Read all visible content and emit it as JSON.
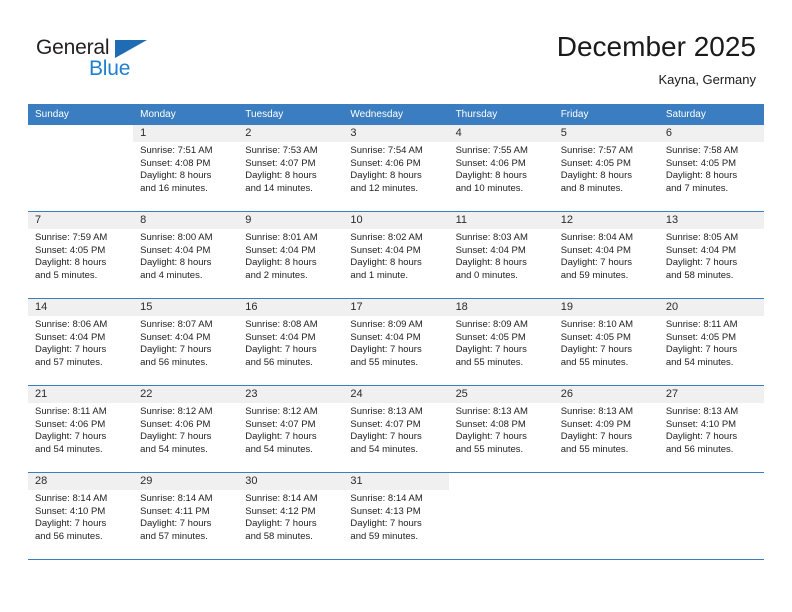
{
  "logo": {
    "word_one": "General",
    "word_two": "Blue",
    "triangle_color": "#1f6cb4",
    "blue_color": "#1f7fd0"
  },
  "header": {
    "title": "December 2025",
    "subtitle": "Kayna, Germany",
    "header_bg": "#3a7dc0",
    "daynum_bg": "#f0f0f0"
  },
  "weekdays": [
    "Sunday",
    "Monday",
    "Tuesday",
    "Wednesday",
    "Thursday",
    "Friday",
    "Saturday"
  ],
  "weeks": [
    [
      {
        "day": "",
        "sunrise": "",
        "sunset": "",
        "daylight1": "",
        "daylight2": ""
      },
      {
        "day": "1",
        "sunrise": "Sunrise: 7:51 AM",
        "sunset": "Sunset: 4:08 PM",
        "daylight1": "Daylight: 8 hours",
        "daylight2": "and 16 minutes."
      },
      {
        "day": "2",
        "sunrise": "Sunrise: 7:53 AM",
        "sunset": "Sunset: 4:07 PM",
        "daylight1": "Daylight: 8 hours",
        "daylight2": "and 14 minutes."
      },
      {
        "day": "3",
        "sunrise": "Sunrise: 7:54 AM",
        "sunset": "Sunset: 4:06 PM",
        "daylight1": "Daylight: 8 hours",
        "daylight2": "and 12 minutes."
      },
      {
        "day": "4",
        "sunrise": "Sunrise: 7:55 AM",
        "sunset": "Sunset: 4:06 PM",
        "daylight1": "Daylight: 8 hours",
        "daylight2": "and 10 minutes."
      },
      {
        "day": "5",
        "sunrise": "Sunrise: 7:57 AM",
        "sunset": "Sunset: 4:05 PM",
        "daylight1": "Daylight: 8 hours",
        "daylight2": "and 8 minutes."
      },
      {
        "day": "6",
        "sunrise": "Sunrise: 7:58 AM",
        "sunset": "Sunset: 4:05 PM",
        "daylight1": "Daylight: 8 hours",
        "daylight2": "and 7 minutes."
      }
    ],
    [
      {
        "day": "7",
        "sunrise": "Sunrise: 7:59 AM",
        "sunset": "Sunset: 4:05 PM",
        "daylight1": "Daylight: 8 hours",
        "daylight2": "and 5 minutes."
      },
      {
        "day": "8",
        "sunrise": "Sunrise: 8:00 AM",
        "sunset": "Sunset: 4:04 PM",
        "daylight1": "Daylight: 8 hours",
        "daylight2": "and 4 minutes."
      },
      {
        "day": "9",
        "sunrise": "Sunrise: 8:01 AM",
        "sunset": "Sunset: 4:04 PM",
        "daylight1": "Daylight: 8 hours",
        "daylight2": "and 2 minutes."
      },
      {
        "day": "10",
        "sunrise": "Sunrise: 8:02 AM",
        "sunset": "Sunset: 4:04 PM",
        "daylight1": "Daylight: 8 hours",
        "daylight2": "and 1 minute."
      },
      {
        "day": "11",
        "sunrise": "Sunrise: 8:03 AM",
        "sunset": "Sunset: 4:04 PM",
        "daylight1": "Daylight: 8 hours",
        "daylight2": "and 0 minutes."
      },
      {
        "day": "12",
        "sunrise": "Sunrise: 8:04 AM",
        "sunset": "Sunset: 4:04 PM",
        "daylight1": "Daylight: 7 hours",
        "daylight2": "and 59 minutes."
      },
      {
        "day": "13",
        "sunrise": "Sunrise: 8:05 AM",
        "sunset": "Sunset: 4:04 PM",
        "daylight1": "Daylight: 7 hours",
        "daylight2": "and 58 minutes."
      }
    ],
    [
      {
        "day": "14",
        "sunrise": "Sunrise: 8:06 AM",
        "sunset": "Sunset: 4:04 PM",
        "daylight1": "Daylight: 7 hours",
        "daylight2": "and 57 minutes."
      },
      {
        "day": "15",
        "sunrise": "Sunrise: 8:07 AM",
        "sunset": "Sunset: 4:04 PM",
        "daylight1": "Daylight: 7 hours",
        "daylight2": "and 56 minutes."
      },
      {
        "day": "16",
        "sunrise": "Sunrise: 8:08 AM",
        "sunset": "Sunset: 4:04 PM",
        "daylight1": "Daylight: 7 hours",
        "daylight2": "and 56 minutes."
      },
      {
        "day": "17",
        "sunrise": "Sunrise: 8:09 AM",
        "sunset": "Sunset: 4:04 PM",
        "daylight1": "Daylight: 7 hours",
        "daylight2": "and 55 minutes."
      },
      {
        "day": "18",
        "sunrise": "Sunrise: 8:09 AM",
        "sunset": "Sunset: 4:05 PM",
        "daylight1": "Daylight: 7 hours",
        "daylight2": "and 55 minutes."
      },
      {
        "day": "19",
        "sunrise": "Sunrise: 8:10 AM",
        "sunset": "Sunset: 4:05 PM",
        "daylight1": "Daylight: 7 hours",
        "daylight2": "and 55 minutes."
      },
      {
        "day": "20",
        "sunrise": "Sunrise: 8:11 AM",
        "sunset": "Sunset: 4:05 PM",
        "daylight1": "Daylight: 7 hours",
        "daylight2": "and 54 minutes."
      }
    ],
    [
      {
        "day": "21",
        "sunrise": "Sunrise: 8:11 AM",
        "sunset": "Sunset: 4:06 PM",
        "daylight1": "Daylight: 7 hours",
        "daylight2": "and 54 minutes."
      },
      {
        "day": "22",
        "sunrise": "Sunrise: 8:12 AM",
        "sunset": "Sunset: 4:06 PM",
        "daylight1": "Daylight: 7 hours",
        "daylight2": "and 54 minutes."
      },
      {
        "day": "23",
        "sunrise": "Sunrise: 8:12 AM",
        "sunset": "Sunset: 4:07 PM",
        "daylight1": "Daylight: 7 hours",
        "daylight2": "and 54 minutes."
      },
      {
        "day": "24",
        "sunrise": "Sunrise: 8:13 AM",
        "sunset": "Sunset: 4:07 PM",
        "daylight1": "Daylight: 7 hours",
        "daylight2": "and 54 minutes."
      },
      {
        "day": "25",
        "sunrise": "Sunrise: 8:13 AM",
        "sunset": "Sunset: 4:08 PM",
        "daylight1": "Daylight: 7 hours",
        "daylight2": "and 55 minutes."
      },
      {
        "day": "26",
        "sunrise": "Sunrise: 8:13 AM",
        "sunset": "Sunset: 4:09 PM",
        "daylight1": "Daylight: 7 hours",
        "daylight2": "and 55 minutes."
      },
      {
        "day": "27",
        "sunrise": "Sunrise: 8:13 AM",
        "sunset": "Sunset: 4:10 PM",
        "daylight1": "Daylight: 7 hours",
        "daylight2": "and 56 minutes."
      }
    ],
    [
      {
        "day": "28",
        "sunrise": "Sunrise: 8:14 AM",
        "sunset": "Sunset: 4:10 PM",
        "daylight1": "Daylight: 7 hours",
        "daylight2": "and 56 minutes."
      },
      {
        "day": "29",
        "sunrise": "Sunrise: 8:14 AM",
        "sunset": "Sunset: 4:11 PM",
        "daylight1": "Daylight: 7 hours",
        "daylight2": "and 57 minutes."
      },
      {
        "day": "30",
        "sunrise": "Sunrise: 8:14 AM",
        "sunset": "Sunset: 4:12 PM",
        "daylight1": "Daylight: 7 hours",
        "daylight2": "and 58 minutes."
      },
      {
        "day": "31",
        "sunrise": "Sunrise: 8:14 AM",
        "sunset": "Sunset: 4:13 PM",
        "daylight1": "Daylight: 7 hours",
        "daylight2": "and 59 minutes."
      },
      {
        "day": "",
        "sunrise": "",
        "sunset": "",
        "daylight1": "",
        "daylight2": ""
      },
      {
        "day": "",
        "sunrise": "",
        "sunset": "",
        "daylight1": "",
        "daylight2": ""
      },
      {
        "day": "",
        "sunrise": "",
        "sunset": "",
        "daylight1": "",
        "daylight2": ""
      }
    ]
  ]
}
